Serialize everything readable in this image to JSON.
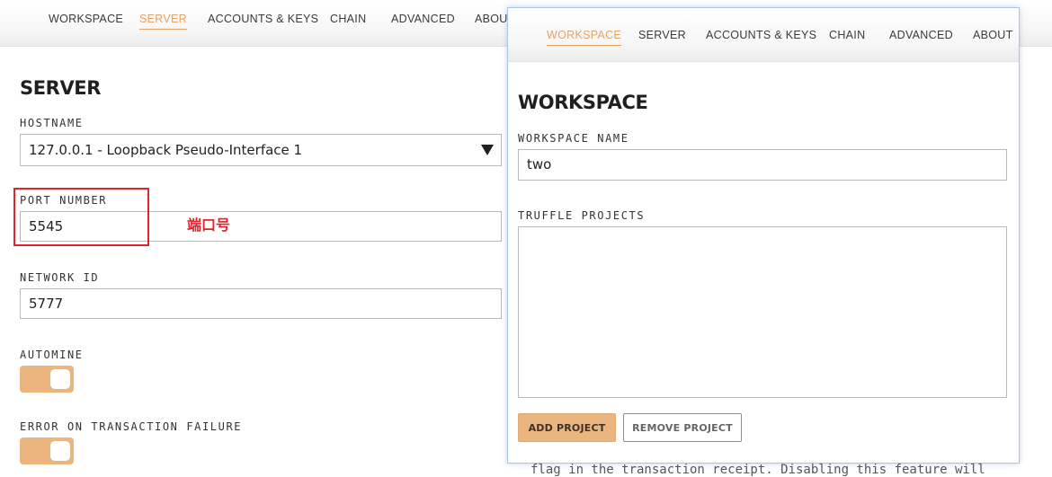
{
  "background_window": {
    "nav": {
      "items": [
        {
          "label": "WORKSPACE",
          "active": false
        },
        {
          "label": "SERVER",
          "active": true
        },
        {
          "label": "ACCOUNTS & KEYS",
          "active": false
        },
        {
          "label": "CHAIN",
          "active": false
        },
        {
          "label": "ADVANCED",
          "active": false
        },
        {
          "label": "ABOUT",
          "active": false
        }
      ]
    },
    "section_title": "SERVER",
    "hostname": {
      "label": "HOSTNAME",
      "value": "127.0.0.1 - Loopback Pseudo-Interface 1",
      "icon": "caret-down-icon"
    },
    "port_number": {
      "label": "PORT NUMBER",
      "value": "5545",
      "annotation": "端口号"
    },
    "network_id": {
      "label": "NETWORK ID",
      "value": "5777"
    },
    "automine": {
      "label": "AUTOMINE",
      "enabled": true
    },
    "error_on_tx_failure": {
      "label": "ERROR ON TRANSACTION FAILURE",
      "enabled": true
    },
    "description_fragment": "flag in the transaction receipt. Disabling this feature will"
  },
  "foreground_window": {
    "nav": {
      "items": [
        {
          "label": "WORKSPACE",
          "active": true
        },
        {
          "label": "SERVER",
          "active": false
        },
        {
          "label": "ACCOUNTS & KEYS",
          "active": false
        },
        {
          "label": "CHAIN",
          "active": false
        },
        {
          "label": "ADVANCED",
          "active": false
        },
        {
          "label": "ABOUT",
          "active": false
        }
      ]
    },
    "section_title": "WORKSPACE",
    "workspace_name": {
      "label": "WORKSPACE NAME",
      "value": "two"
    },
    "truffle_projects": {
      "label": "TRUFFLE PROJECTS",
      "items": []
    },
    "buttons": {
      "add_project": "ADD PROJECT",
      "remove_project": "REMOVE PROJECT"
    }
  },
  "colors": {
    "accent": "#e6a262",
    "toggle_on": "#eab57f",
    "annotation_red": "#e0242c",
    "window_border": "#a9c4e8"
  }
}
